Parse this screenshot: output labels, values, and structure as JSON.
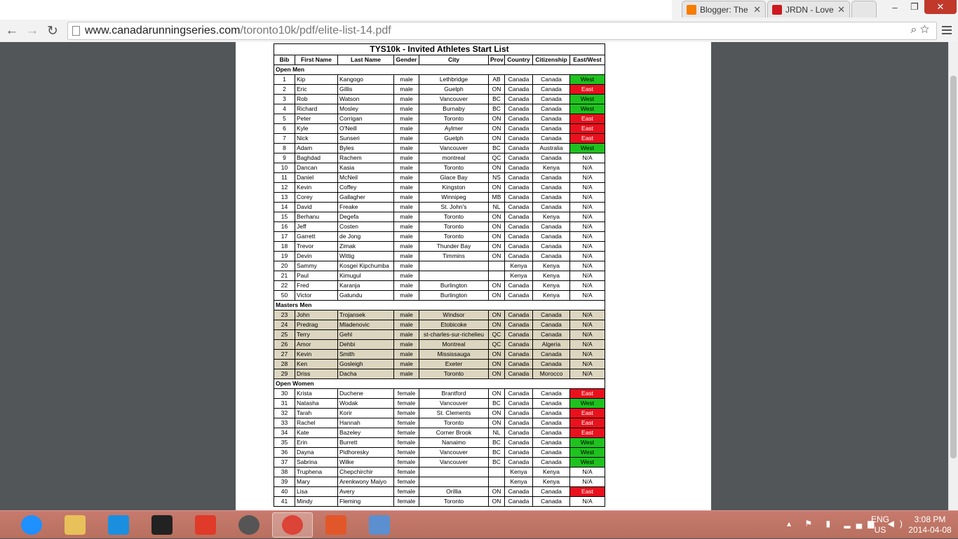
{
  "browser": {
    "tabs": [
      {
        "title": "Blogger: The",
        "favicon_color": "#f57d00"
      },
      {
        "title": "JRDN - Love",
        "favicon_color": "#cc181e"
      }
    ],
    "url_host": "www.canadarunningseries.com",
    "url_path": "/toronto10k/pdf/elite-list-14.pdf",
    "nav": {
      "back": "←",
      "forward": "→",
      "reload": "↻"
    },
    "window_buttons": {
      "minimize": "–",
      "restore": "❐",
      "close": "✕"
    },
    "omni_icons": "⌕ ☆"
  },
  "document": {
    "title": "TYS10k - Invited Athletes Start List",
    "headers": [
      "Bib",
      "First Name",
      "Last Name",
      "Gender",
      "City",
      "Prov",
      "Country",
      "Citizenship",
      "East/West"
    ],
    "sections": [
      {
        "name": "Open Men",
        "style": "plain",
        "rows": [
          [
            "1",
            "Kip",
            "Kangogo",
            "male",
            "Lethbridge",
            "AB",
            "Canada",
            "Canada",
            "West"
          ],
          [
            "2",
            "Eric",
            "Gillis",
            "male",
            "Guelph",
            "ON",
            "Canada",
            "Canada",
            "East"
          ],
          [
            "3",
            "Rob",
            "Watson",
            "male",
            "Vancouver",
            "BC",
            "Canada",
            "Canada",
            "West"
          ],
          [
            "4",
            "Richard",
            "Mosley",
            "male",
            "Burnaby",
            "BC",
            "Canada",
            "Canada",
            "West"
          ],
          [
            "5",
            "Peter",
            "Corrigan",
            "male",
            "Toronto",
            "ON",
            "Canada",
            "Canada",
            "East"
          ],
          [
            "6",
            "Kyle",
            "O'Neill",
            "male",
            "Aylmer",
            "ON",
            "Canada",
            "Canada",
            "East"
          ],
          [
            "7",
            "Nick",
            "Sunseri",
            "male",
            "Guelph",
            "ON",
            "Canada",
            "Canada",
            "East"
          ],
          [
            "8",
            "Adam",
            "Byles",
            "male",
            "Vancouver",
            "BC",
            "Canada",
            "Australia",
            "West"
          ],
          [
            "9",
            "Baghdad",
            "Rachem",
            "male",
            "montreal",
            "QC",
            "Canada",
            "Canada",
            "N/A"
          ],
          [
            "10",
            "Dancan",
            "Kasia",
            "male",
            "Toronto",
            "ON",
            "Canada",
            "Kenya",
            "N/A"
          ],
          [
            "11",
            "Daniel",
            "McNeil",
            "male",
            "Glace Bay",
            "NS",
            "Canada",
            "Canada",
            "N/A"
          ],
          [
            "12",
            "Kevin",
            "Coffey",
            "male",
            "Kingston",
            "ON",
            "Canada",
            "Canada",
            "N/A"
          ],
          [
            "13",
            "Corey",
            "Gallagher",
            "male",
            "Winnipeg",
            "MB",
            "Canada",
            "Canada",
            "N/A"
          ],
          [
            "14",
            "David",
            "Freake",
            "male",
            "St. John's",
            "NL",
            "Canada",
            "Canada",
            "N/A"
          ],
          [
            "15",
            "Berhanu",
            "Degefa",
            "male",
            "Toronto",
            "ON",
            "Canada",
            "Kenya",
            "N/A"
          ],
          [
            "16",
            "Jeff",
            "Costen",
            "male",
            "Toronto",
            "ON",
            "Canada",
            "Canada",
            "N/A"
          ],
          [
            "17",
            "Garrett",
            "de Jong",
            "male",
            "Toronto",
            "ON",
            "Canada",
            "Canada",
            "N/A"
          ],
          [
            "18",
            "Trevor",
            "Zimak",
            "male",
            "Thunder Bay",
            "ON",
            "Canada",
            "Canada",
            "N/A"
          ],
          [
            "19",
            "Devin",
            "Wittig",
            "male",
            "Timmins",
            "ON",
            "Canada",
            "Canada",
            "N/A"
          ],
          [
            "20",
            "Sammy",
            "Kosgei Kipchumba",
            "male",
            "",
            "",
            "Kenya",
            "Kenya",
            "N/A"
          ],
          [
            "21",
            "Paul",
            "Kimugul",
            "male",
            "",
            "",
            "Kenya",
            "Kenya",
            "N/A"
          ],
          [
            "22",
            "Fred",
            "Karanja",
            "male",
            "Burlington",
            "ON",
            "Canada",
            "Kenya",
            "N/A"
          ],
          [
            "50",
            "Victor",
            "Gatundu",
            "male",
            "Burlington",
            "ON",
            "Canada",
            "Kenya",
            "N/A"
          ]
        ]
      },
      {
        "name": "Masters Men",
        "style": "masters",
        "rows": [
          [
            "23",
            "John",
            "Trojansek",
            "male",
            "Windsor",
            "ON",
            "Canada",
            "Canada",
            "N/A"
          ],
          [
            "24",
            "Predrag",
            "Mladenovic",
            "male",
            "Etobicoke",
            "ON",
            "Canada",
            "Canada",
            "N/A"
          ],
          [
            "25",
            "Terry",
            "Gehl",
            "male",
            "st-charles-sur-richelieu",
            "QC",
            "Canada",
            "Canada",
            "N/A"
          ],
          [
            "26",
            "Amor",
            "Dehbi",
            "male",
            "Montreal",
            "QC",
            "Canada",
            "Algeria",
            "N/A"
          ],
          [
            "27",
            "Kevin",
            "Smith",
            "male",
            "Mississauga",
            "ON",
            "Canada",
            "Canada",
            "N/A"
          ],
          [
            "28",
            "Ken",
            "Gosleigh",
            "male",
            "Exeter",
            "ON",
            "Canada",
            "Canada",
            "N/A"
          ],
          [
            "29",
            "Driss",
            "Dacha",
            "male",
            "Toronto",
            "ON",
            "Canada",
            "Morocco",
            "N/A"
          ]
        ]
      },
      {
        "name": "Open Women",
        "style": "plain",
        "rows": [
          [
            "30",
            "Krista",
            "Duchene",
            "female",
            "Brantford",
            "ON",
            "Canada",
            "Canada",
            "East"
          ],
          [
            "31",
            "Natasha",
            "Wodak",
            "female",
            "Vancouver",
            "BC",
            "Canada",
            "Canada",
            "West"
          ],
          [
            "32",
            "Tarah",
            "Korir",
            "female",
            "St. Clements",
            "ON",
            "Canada",
            "Canada",
            "East"
          ],
          [
            "33",
            "Rachel",
            "Hannah",
            "female",
            "Toronto",
            "ON",
            "Canada",
            "Canada",
            "East"
          ],
          [
            "34",
            "Kate",
            "Bazeley",
            "female",
            "Corner Brook",
            "NL",
            "Canada",
            "Canada",
            "East"
          ],
          [
            "35",
            "Erin",
            "Burrett",
            "female",
            "Nanaimo",
            "BC",
            "Canada",
            "Canada",
            "West"
          ],
          [
            "36",
            "Dayna",
            "Pidhoresky",
            "female",
            "Vancouver",
            "BC",
            "Canada",
            "Canada",
            "West"
          ],
          [
            "37",
            "Sabrina",
            "Wilke",
            "female",
            "Vancouver",
            "BC",
            "Canada",
            "Canada",
            "West"
          ],
          [
            "38",
            "Truphena",
            "Chepchirchir",
            "female",
            "",
            "",
            "Kenya",
            "Kenya",
            "N/A"
          ],
          [
            "39",
            "Mary",
            "Arenkwony Maiyo",
            "female",
            "",
            "",
            "Kenya",
            "Kenya",
            "N/A"
          ],
          [
            "40",
            "Lisa",
            "Avery",
            "female",
            "Orillia",
            "ON",
            "Canada",
            "Canada",
            "East"
          ],
          [
            "41",
            "Mindy",
            "Fleming",
            "female",
            "Toronto",
            "ON",
            "Canada",
            "Canada",
            "N/A"
          ]
        ]
      }
    ],
    "colors": {
      "west": "#1fc21f",
      "east": "#e8111d",
      "masters_row": "#dcd6c0"
    }
  },
  "taskbar": {
    "items": [
      {
        "name": "internet-explorer",
        "color": "#1e90ff"
      },
      {
        "name": "file-explorer",
        "color": "#e8c15a"
      },
      {
        "name": "app-rocket",
        "color": "#1a8fe0"
      },
      {
        "name": "app-camera",
        "color": "#222222"
      },
      {
        "name": "app-colorful",
        "color": "#e03a2a"
      },
      {
        "name": "hp",
        "color": "#555555"
      },
      {
        "name": "chrome",
        "color": "#db4437",
        "active": true
      },
      {
        "name": "app-equalizer",
        "color": "#e2572a"
      },
      {
        "name": "app-photos",
        "color": "#5b8fd0"
      }
    ],
    "lang_top": "ENG",
    "lang_bottom": "US",
    "time": "3:08 PM",
    "date": "2014-04-08",
    "tray_icons": "▴ ⚑ ▮ ▂▄▆ ◀)"
  }
}
